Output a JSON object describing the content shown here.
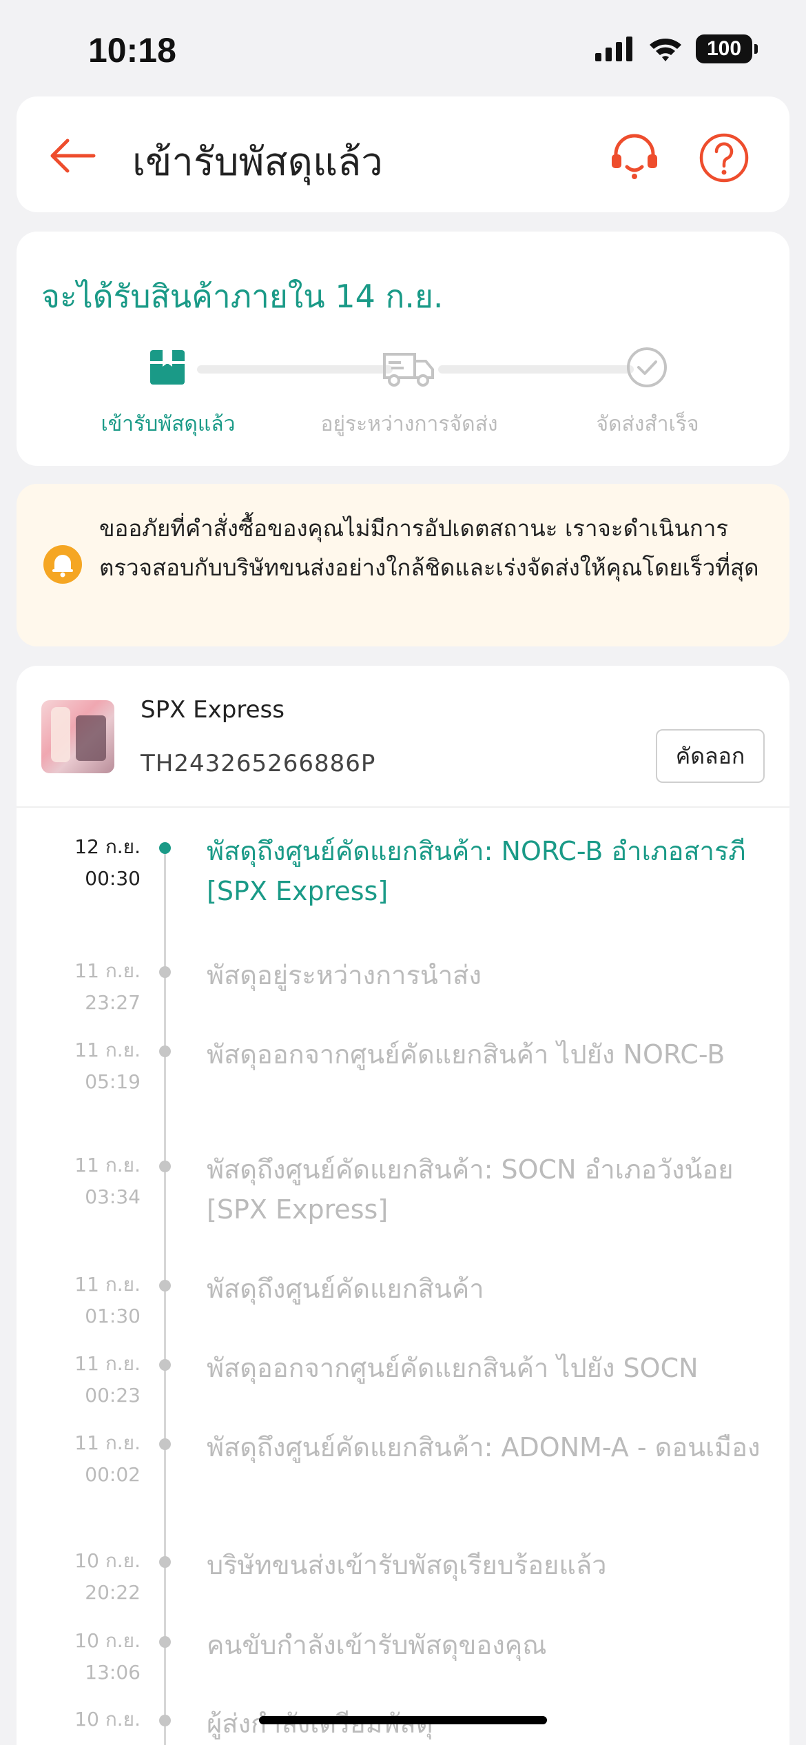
{
  "status_bar": {
    "time": "10:18",
    "battery": "100"
  },
  "header": {
    "title": "เข้ารับพัสดุแล้ว"
  },
  "delivery": {
    "eta": "จะได้รับสินค้าภายใน 14 ก.ย.",
    "steps": [
      {
        "label": "เข้ารับพัสดุแล้ว",
        "active": true,
        "icon": "package-icon"
      },
      {
        "label": "อยู่ระหว่างการจัดส่ง",
        "active": false,
        "icon": "truck-icon"
      },
      {
        "label": "จัดส่งสำเร็จ",
        "active": false,
        "icon": "check-circle-icon"
      }
    ]
  },
  "notice": {
    "text": "ขออภัยที่คำสั่งซื้อของคุณไม่มีการอัปเดตสถานะ เราจะดำเนินการตรวจสอบกับบริษัทขนส่งอย่างใกล้ชิดและเร่งจัดส่งให้คุณโดยเร็วที่สุด"
  },
  "tracking": {
    "carrier": "SPX Express",
    "number": "TH243265266886P",
    "copy_label": "คัดลอก",
    "events": [
      {
        "date": "12 ก.ย.",
        "time": "00:30",
        "text": "พัสดุถึงศูนย์คัดแยกสินค้า: NORC-B อำเภอสารภี [SPX Express]",
        "current": true
      },
      {
        "date": "11 ก.ย.",
        "time": "23:27",
        "text": "พัสดุอยู่ระหว่างการนำส่ง",
        "current": false
      },
      {
        "date": "11 ก.ย.",
        "time": "05:19",
        "text": "พัสดุออกจากศูนย์คัดแยกสินค้า ไปยัง NORC-B",
        "current": false
      },
      {
        "date": "11 ก.ย.",
        "time": "03:34",
        "text": "พัสดุถึงศูนย์คัดแยกสินค้า: SOCN อำเภอวังน้อย [SPX Express]",
        "current": false
      },
      {
        "date": "11 ก.ย.",
        "time": "01:30",
        "text": "พัสดุถึงศูนย์คัดแยกสินค้า",
        "current": false
      },
      {
        "date": "11 ก.ย.",
        "time": "00:23",
        "text": "พัสดุออกจากศูนย์คัดแยกสินค้า ไปยัง SOCN",
        "current": false
      },
      {
        "date": "11 ก.ย.",
        "time": "00:02",
        "text": "พัสดุถึงศูนย์คัดแยกสินค้า: ADONM-A - ดอนเมือง",
        "current": false
      },
      {
        "date": "10 ก.ย.",
        "time": "20:22",
        "text": "บริษัทขนส่งเข้ารับพัสดุเรียบร้อยแล้ว",
        "current": false
      },
      {
        "date": "10 ก.ย.",
        "time": "13:06",
        "text": "คนขับกำลังเข้ารับพัสดุของคุณ",
        "current": false
      },
      {
        "date": "10 ก.ย.",
        "time": "",
        "text": "ผู้ส่งกำลังเตรียมพัสดุ",
        "current": false
      }
    ]
  },
  "colors": {
    "accent": "#1a9a87",
    "brand": "#ee4d2d",
    "notice_bg": "#fff8ec",
    "notice_icon": "#f5a623"
  }
}
